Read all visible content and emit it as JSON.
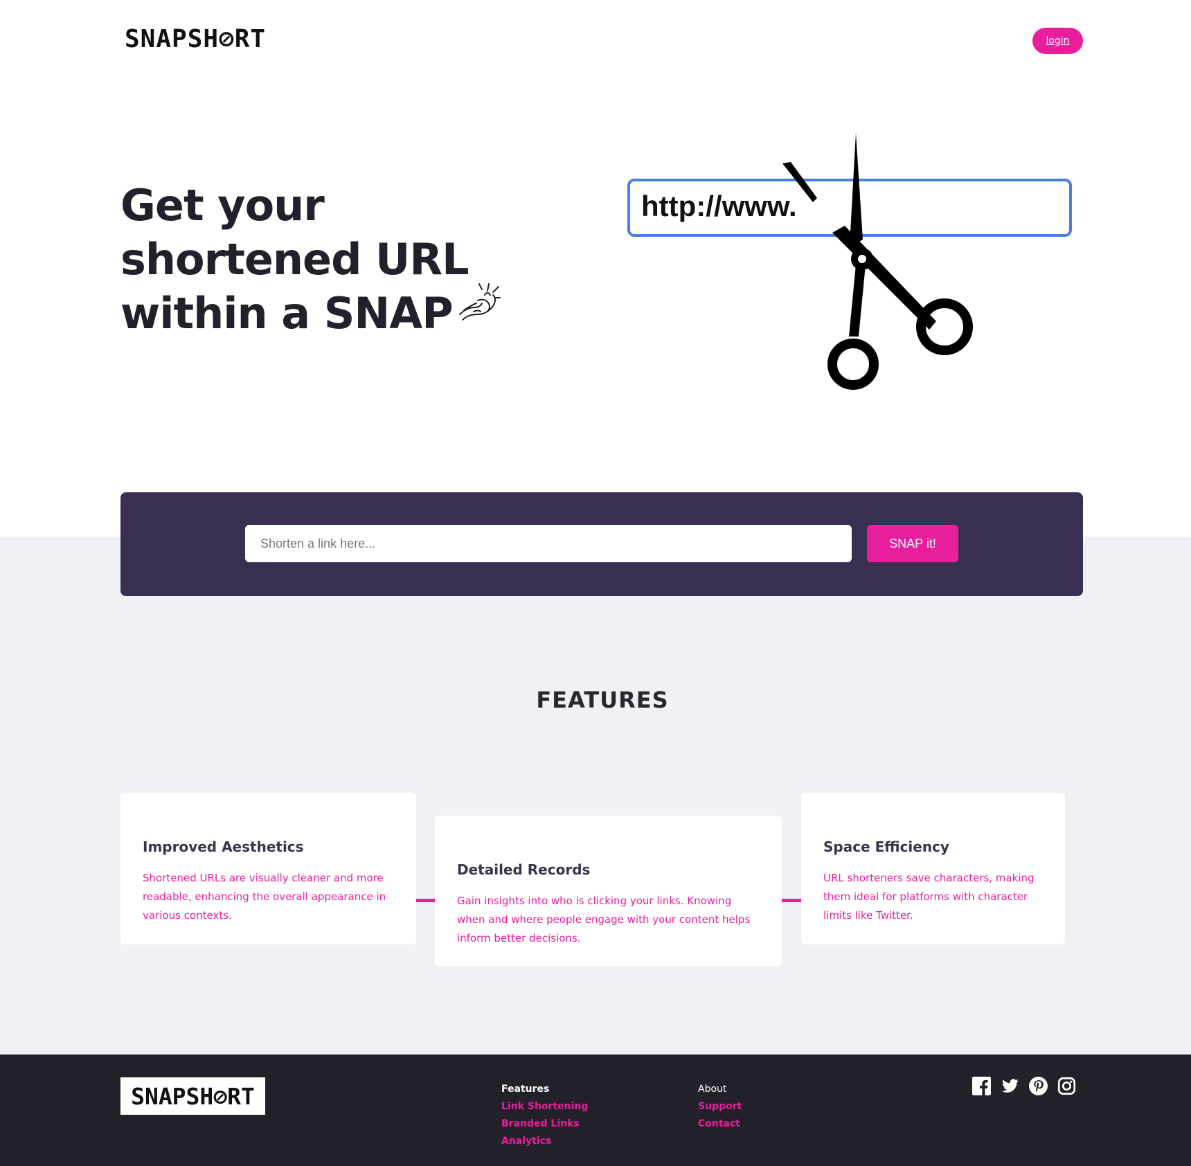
{
  "header": {
    "logo_text": "SNAPSH",
    "logo_link_glyph": "⊘",
    "logo_text_end": "RT",
    "login_label": "login"
  },
  "hero": {
    "title_line1": "Get your",
    "title_line2": "shortened URL",
    "title_line3": "within a SNAP",
    "illustration_url_text": "http://www."
  },
  "shorten": {
    "placeholder": "Shorten a link here...",
    "button_label": "SNAP it!"
  },
  "features": {
    "heading": "FEATURES",
    "cards": [
      {
        "title": "Improved Aesthetics",
        "text": "Shortened URLs are visually cleaner and more readable, enhancing the overall appearance in various contexts."
      },
      {
        "title": "Detailed Records",
        "text": "Gain insights into who is clicking your links. Knowing when and where people engage with your content helps inform better decisions."
      },
      {
        "title": "Space Efficiency",
        "text": "URL shorteners save characters, making them ideal for platforms with character limits like Twitter."
      }
    ]
  },
  "footer": {
    "logo_text": "SNAPSH",
    "logo_link_glyph": "⊘",
    "logo_text_end": "RT",
    "col1": {
      "heading": "Features",
      "links": [
        "Link Shortening",
        "Branded Links",
        "Analytics"
      ]
    },
    "col2": {
      "heading": "About",
      "links": [
        "Support",
        "Contact"
      ]
    },
    "socials": [
      "facebook-icon",
      "twitter-icon",
      "pinterest-icon",
      "instagram-icon"
    ]
  },
  "colors": {
    "accent": "#e91e9c",
    "panel": "#3b2f51",
    "footer_bg": "#232029",
    "band_bg": "#f0f1f5",
    "url_border": "#4a7fe0"
  }
}
